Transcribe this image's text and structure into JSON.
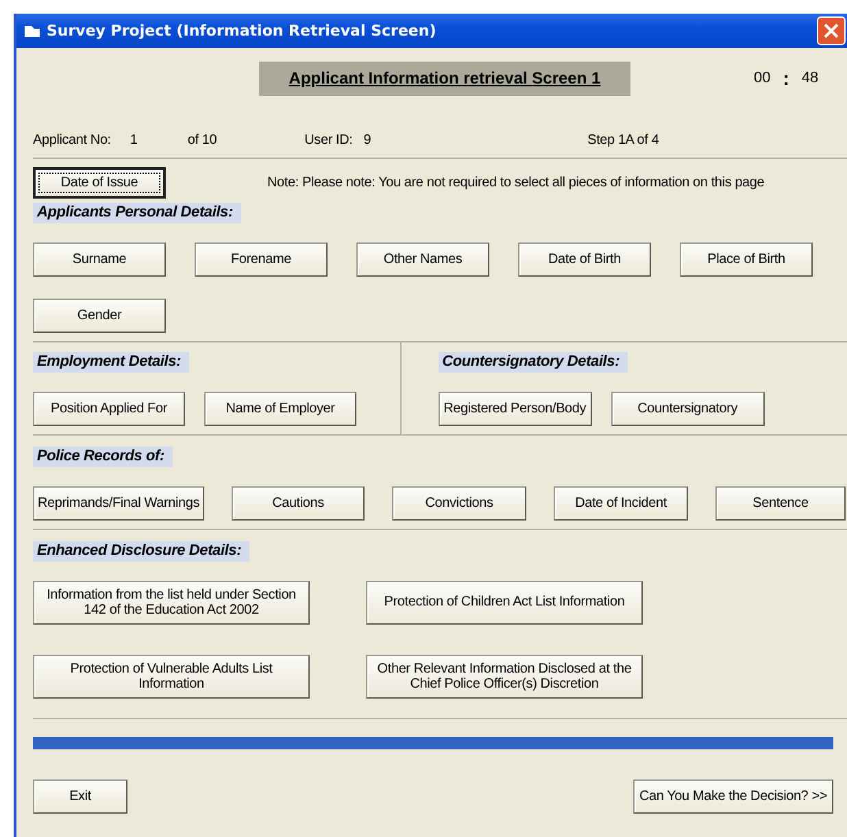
{
  "window": {
    "title": "Survey Project (Information Retrieval Screen)"
  },
  "header": {
    "title": "Applicant Information retrieval Screen 1",
    "timer_minutes": "00",
    "timer_separator": ":",
    "timer_seconds": "48"
  },
  "info": {
    "applicant_label": "Applicant No:",
    "applicant_no": "1",
    "applicant_of": "of 10",
    "user_label": "User ID:",
    "user_id": "9",
    "step": "Step 1A of 4"
  },
  "date_of_issue": {
    "label": "Date of Issue",
    "focused": true
  },
  "note": "Note: Please note: You are not required to select all pieces of information on this page",
  "personal": {
    "heading": "Applicants Personal Details:",
    "buttons": [
      "Surname",
      "Forename",
      "Other Names",
      "Date of Birth",
      "Place of Birth",
      "Gender"
    ]
  },
  "employment": {
    "heading": "Employment Details:",
    "buttons": [
      "Position Applied For",
      "Name of Employer"
    ]
  },
  "countersignatory": {
    "heading": "Countersignatory Details:",
    "buttons": [
      "Registered Person/Body",
      "Countersignatory"
    ]
  },
  "police": {
    "heading": "Police Records of:",
    "buttons": [
      "Reprimands/Final Warnings",
      "Cautions",
      "Convictions",
      "Date of Incident",
      "Sentence"
    ]
  },
  "enhanced": {
    "heading": "Enhanced Disclosure Details:",
    "buttons": [
      "Information from the list held under Section 142 of the Education Act 2002",
      "Protection of Children Act List Information",
      "Protection of Vulnerable Adults List Information",
      "Other Relevant Information Disclosed at the Chief Police Officer(s) Discretion"
    ]
  },
  "progress": {
    "level": 1
  },
  "footer": {
    "exit": "Exit",
    "decision": "Can You Make the Decision? >>"
  }
}
